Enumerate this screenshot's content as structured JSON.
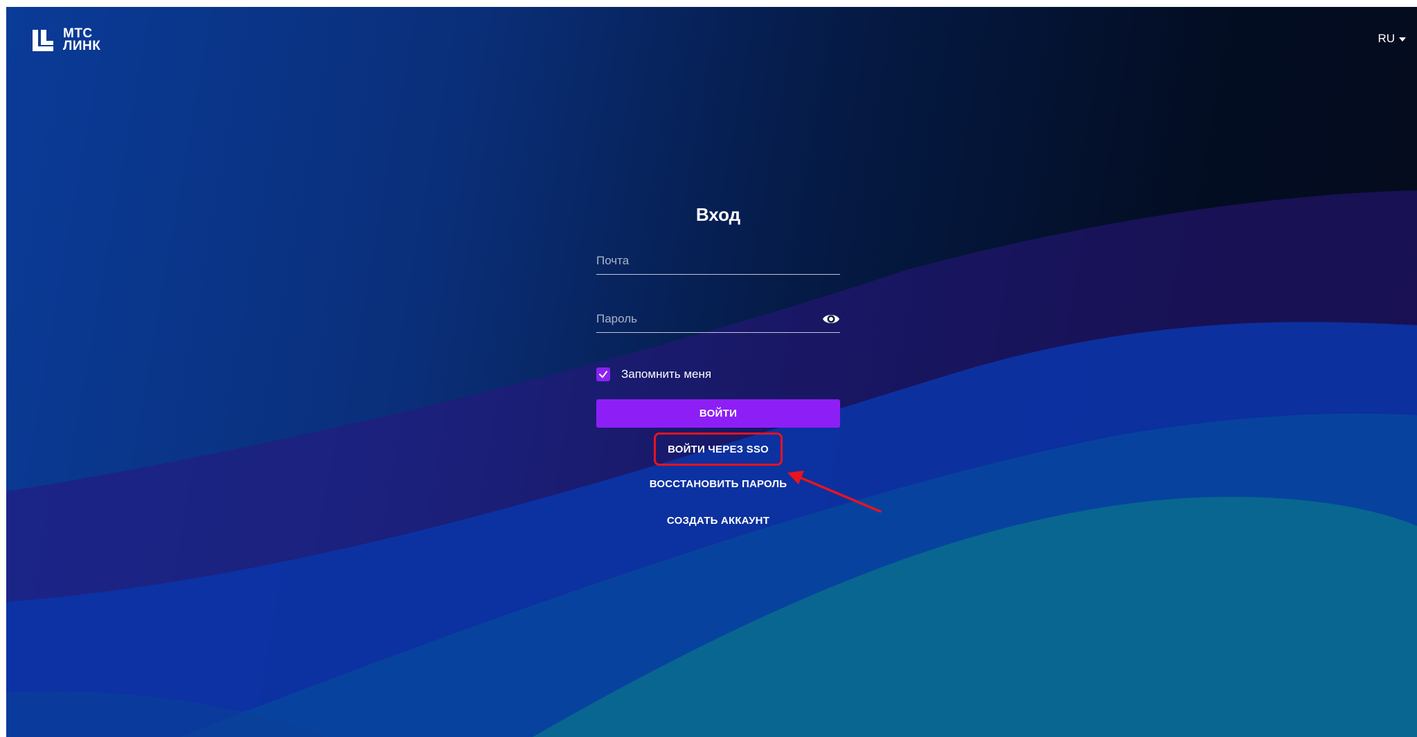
{
  "app": {
    "logo_line1": "МТС",
    "logo_line2": "ЛИНК"
  },
  "header": {
    "language": "RU"
  },
  "login_form": {
    "title": "Вход",
    "email_placeholder": "Почта",
    "password_placeholder": "Пароль",
    "remember_label": "Запомнить меня",
    "remember_checked": true,
    "submit_label": "ВОЙТИ",
    "sso_label": "ВОЙТИ ЧЕРЕЗ SSO",
    "recover_label": "ВОССТАНОВИТЬ ПАРОЛЬ",
    "create_label": "СОЗДАТЬ АККАУНТ"
  },
  "icons": {
    "logo": "mts-link-logo-icon",
    "language_caret": "caret-down-icon",
    "password_toggle": "eye-icon",
    "checkbox": "checkmark-icon"
  },
  "colors": {
    "accent": "#8d1ff6",
    "annotation": "#e8141e"
  }
}
